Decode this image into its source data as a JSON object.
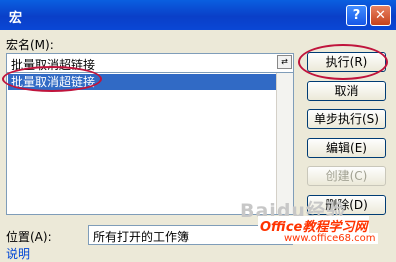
{
  "window": {
    "title": "宏",
    "help": "?",
    "close": "✕"
  },
  "macro_name": {
    "label": "宏名(M):",
    "value": "批量取消超链接",
    "picker": "⇄"
  },
  "macro_list": {
    "items": [
      "批量取消超链接"
    ]
  },
  "buttons": {
    "run": "执行(R)",
    "cancel": "取消",
    "step": "单步执行(S)",
    "edit": "编辑(E)",
    "create": "创建(C)",
    "delete": "删除(D)"
  },
  "location": {
    "label": "位置(A):",
    "value": "所有打开的工作簿"
  },
  "description_label": "说明",
  "watermark": {
    "baidu": "Baidu经验",
    "site": "Office教程学习网",
    "url": "www.office68.com"
  }
}
